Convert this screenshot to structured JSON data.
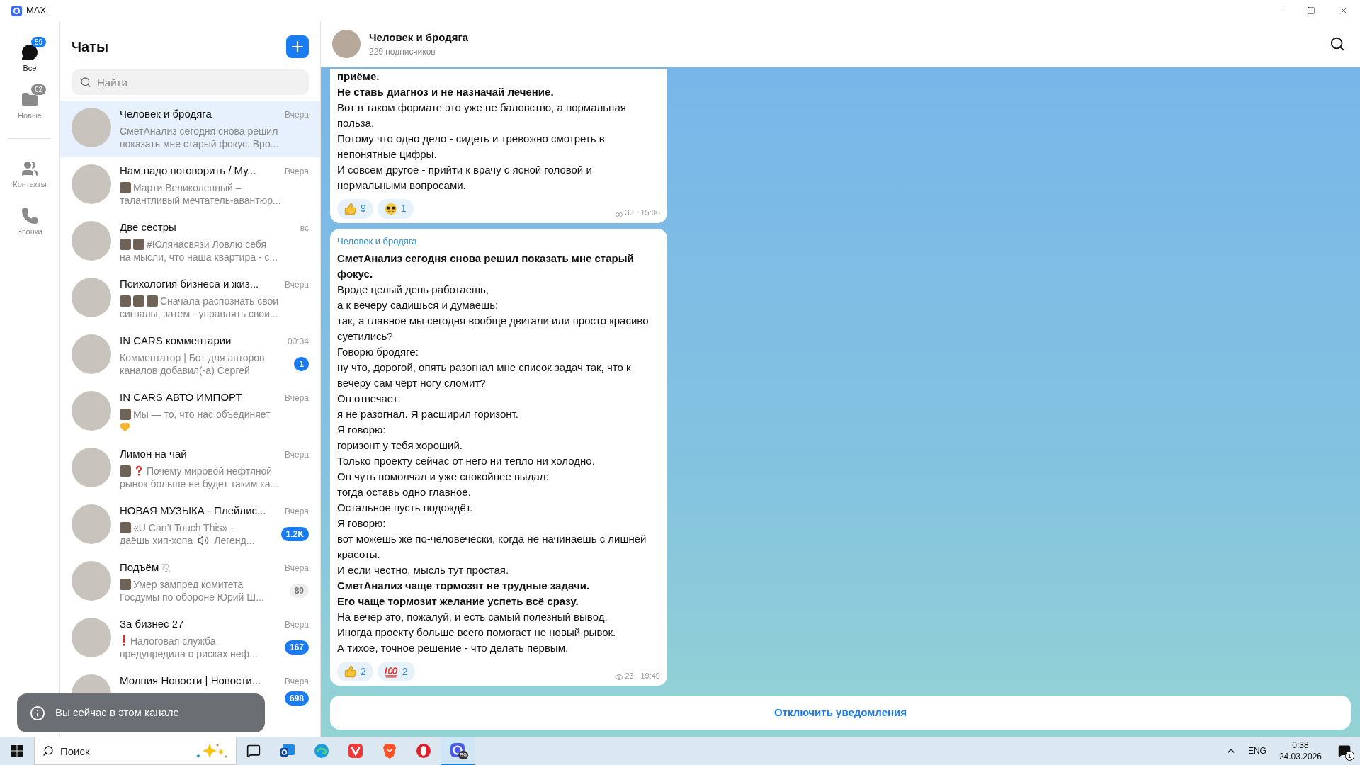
{
  "window": {
    "title": "MAX"
  },
  "rail": [
    {
      "kind": "chats",
      "label": "Все",
      "badge": "59",
      "selected": true
    },
    {
      "kind": "folder",
      "label": "Новые",
      "badge": "62",
      "selected": false
    },
    {
      "kind": "contacts",
      "label": "Контакты",
      "selected": false
    },
    {
      "kind": "calls",
      "label": "Звонки",
      "selected": false
    }
  ],
  "chat_list": {
    "title": "Чаты",
    "search": {
      "placeholder": "Найти"
    },
    "chats": [
      {
        "title": "Человек и бродяга",
        "time": "Вчера",
        "selected": true,
        "preview": [
          [
            {
              "kind": "text",
              "text": "СметАнализ сегодня снова решил"
            }
          ],
          [
            {
              "kind": "text",
              "text": "показать мне старый фокус. Вро..."
            }
          ]
        ]
      },
      {
        "title": "Нам надо поговорить / Му...",
        "time": "Вчера",
        "selected": false,
        "preview": [
          [
            {
              "kind": "thumb"
            },
            {
              "kind": "text",
              "text": "Марти Великолепный –"
            }
          ],
          [
            {
              "kind": "text",
              "text": "талантливый мечтатель-авантюр..."
            }
          ]
        ]
      },
      {
        "title": "Две сестры",
        "time": "вс",
        "selected": false,
        "preview": [
          [
            {
              "kind": "thumb"
            },
            {
              "kind": "thumb"
            },
            {
              "kind": "text",
              "text": "#Юлянасвязи   Ловлю себя"
            }
          ],
          [
            {
              "kind": "text",
              "text": "на мысли, что наша квартира - с..."
            }
          ]
        ]
      },
      {
        "title": "Психология бизнеса и жиз...",
        "time": "Вчера",
        "selected": false,
        "preview": [
          [
            {
              "kind": "thumb"
            },
            {
              "kind": "thumb"
            },
            {
              "kind": "thumb"
            },
            {
              "kind": "text",
              "text": "Сначала распознать свои"
            }
          ],
          [
            {
              "kind": "text",
              "text": "сигналы, затем - управлять свои..."
            }
          ]
        ]
      },
      {
        "title": "IN CARS комментарии",
        "time": "00:34",
        "selected": false,
        "badge": {
          "text": "1",
          "muted": false
        },
        "preview": [
          [
            {
              "kind": "text",
              "text": "Комментатор | Бот для авторов"
            }
          ],
          [
            {
              "kind": "text",
              "text": "каналов добавил(-а) Сергей"
            }
          ]
        ]
      },
      {
        "title": "IN CARS АВТО ИМПОРТ",
        "time": "Вчера",
        "selected": false,
        "preview": [
          [
            {
              "kind": "thumb"
            },
            {
              "kind": "text",
              "text": "Мы — то, что нас объединяет"
            }
          ],
          [
            {
              "kind": "heart"
            }
          ]
        ]
      },
      {
        "title": "Лимон на чай",
        "time": "Вчера",
        "selected": false,
        "preview": [
          [
            {
              "kind": "thumb"
            },
            {
              "kind": "question"
            },
            {
              "kind": "text",
              "text": "Почему мировой нефтяной"
            }
          ],
          [
            {
              "kind": "text",
              "text": "рынок больше не будет таким ка..."
            }
          ]
        ]
      },
      {
        "title": "НОВАЯ МУЗЫКА - Плейлис...",
        "time": "Вчера",
        "selected": false,
        "badge": {
          "text": "1.2K",
          "muted": false
        },
        "preview": [
          [
            {
              "kind": "thumb"
            },
            {
              "kind": "text",
              "text": "«U Can’t Touch This» -"
            }
          ],
          [
            {
              "kind": "text",
              "text": "даёшь хип-хопа"
            },
            {
              "kind": "speaker"
            },
            {
              "kind": "text",
              "text": "Легенд..."
            }
          ]
        ]
      },
      {
        "title": "Подъём",
        "time": "Вчера",
        "selected": false,
        "muted": true,
        "badge": {
          "text": "89",
          "muted": true
        },
        "preview": [
          [
            {
              "kind": "thumb"
            },
            {
              "kind": "text",
              "text": "Умер зампред комитета"
            }
          ],
          [
            {
              "kind": "text",
              "text": "Госдумы по обороне Юрий Ш..."
            }
          ]
        ]
      },
      {
        "title": "За бизнес 27",
        "time": "Вчера",
        "selected": false,
        "badge": {
          "text": "167",
          "muted": false
        },
        "preview": [
          [
            {
              "kind": "exclamation"
            },
            {
              "kind": "text",
              "text": "Налоговая служба"
            }
          ],
          [
            {
              "kind": "text",
              "text": "предупредила о рисках неф..."
            }
          ]
        ]
      },
      {
        "title": "Молния Новости | Новости...",
        "time": "Вчера",
        "selected": false,
        "badge": {
          "text": "698",
          "muted": false
        }
      }
    ]
  },
  "toast": {
    "text": "Вы сейчас в этом канале"
  },
  "channel": {
    "title": "Человек и бродяга",
    "subtitle": "229 подписчиков"
  },
  "messages": [
    {
      "lines": [
        {
          "text": "приёме.",
          "bold": true
        },
        {
          "text": "Не ставь диагноз и не назначай лечение.",
          "bold": true
        },
        {
          "text": "Вот в таком формате это уже не баловство, а нормальная польза.",
          "bold": false
        },
        {
          "text": "Потому что одно дело - сидеть и тревожно смотреть в непонятные цифры.",
          "bold": false
        },
        {
          "text": "И совсем другое - прийти к врачу с ясной головой и нормальными вопросами.",
          "bold": false
        }
      ],
      "reactions": [
        {
          "kind": "thumbs_up",
          "count": "9"
        },
        {
          "kind": "cool",
          "count": "1"
        }
      ],
      "meta": "33 · 15:06"
    },
    {
      "author": "Человек и бродяга",
      "lines": [
        {
          "text": "СметАнализ сегодня снова решил показать мне старый фокус.",
          "bold": true
        },
        {
          "text": "Вроде целый день работаешь,",
          "bold": false
        },
        {
          "text": "а к вечеру садишься и думаешь:",
          "bold": false
        },
        {
          "text": "так, а главное мы сегодня вообще двигали или просто красиво суетились?",
          "bold": false
        },
        {
          "text": "Говорю бродяге:",
          "bold": false
        },
        {
          "text": "ну что, дорогой, опять разогнал мне список задач так, что к вечеру сам чёрт ногу сломит?",
          "bold": false
        },
        {
          "text": "Он отвечает:",
          "bold": false
        },
        {
          "text": "я не разогнал. Я расширил горизонт.",
          "bold": false
        },
        {
          "text": "Я говорю:",
          "bold": false
        },
        {
          "text": "горизонт у тебя хороший.",
          "bold": false
        },
        {
          "text": "Только проекту сейчас от него ни тепло ни холодно.",
          "bold": false
        },
        {
          "text": "Он чуть помолчал и уже спокойнее выдал:",
          "bold": false
        },
        {
          "text": "тогда оставь одно главное.",
          "bold": false
        },
        {
          "text": "Остальное пусть подождёт.",
          "bold": false
        },
        {
          "text": "Я говорю:",
          "bold": false
        },
        {
          "text": "вот можешь же по-человечески, когда не начинаешь с лишней красоты.",
          "bold": false
        },
        {
          "text": "И если честно, мысль тут простая.",
          "bold": false
        },
        {
          "text": "СметАнализ чаще тормозят не трудные задачи.",
          "bold": true
        },
        {
          "text": "Его чаще тормозит желание успеть всё сразу.",
          "bold": true
        },
        {
          "text": "На вечер это, пожалуй, и есть самый полезный вывод.",
          "bold": false
        },
        {
          "text": "Иногда проекту больше всего помогает не новый рывок.",
          "bold": false
        },
        {
          "text": "А тихое, точное решение - что делать первым.",
          "bold": false
        }
      ],
      "reactions": [
        {
          "kind": "thumbs_up",
          "count": "2"
        },
        {
          "kind": "hundred",
          "count": "2"
        }
      ],
      "meta": "23 · 19:49"
    }
  ],
  "footer": {
    "button": "Отключить уведомления"
  },
  "taskbar": {
    "search": {
      "placeholder": "Поиск"
    },
    "apps": [
      {
        "kind": "mail",
        "selected": false
      },
      {
        "kind": "edge",
        "selected": false
      },
      {
        "kind": "vivaldi",
        "selected": false
      },
      {
        "kind": "brave",
        "selected": false
      },
      {
        "kind": "opera",
        "selected": false
      },
      {
        "kind": "max",
        "selected": true,
        "badge": "59"
      }
    ],
    "language": "ENG",
    "time": "0:38",
    "date": "24.03.2026",
    "notifications": "1"
  }
}
